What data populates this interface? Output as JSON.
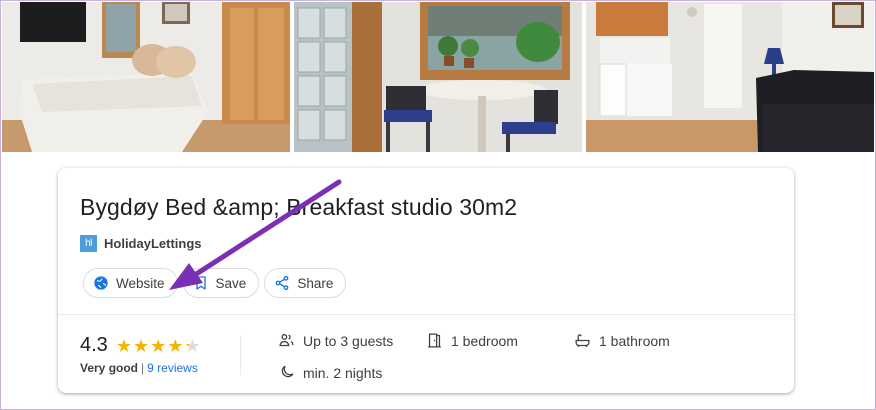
{
  "listing": {
    "title": "Bygdøy Bed &amp; Breakfast studio 30m2",
    "provider": {
      "logo_text": "hl",
      "name": "HolidayLettings",
      "logo_color": "#4b9fd9"
    },
    "actions": [
      {
        "label": "Website",
        "icon": "globe-icon"
      },
      {
        "label": "Save",
        "icon": "bookmark-icon"
      },
      {
        "label": "Share",
        "icon": "share-icon"
      }
    ],
    "rating": {
      "value": "4.3",
      "stars": 4.3,
      "max_stars": 5,
      "quality": "Very good",
      "separator": "|",
      "reviews": "9 reviews",
      "star_color": "#f4b400"
    },
    "features": [
      {
        "label": "Up to 3 guests",
        "icon": "guests-icon"
      },
      {
        "label": "1 bedroom",
        "icon": "door-icon"
      },
      {
        "label": "1 bathroom",
        "icon": "bathtub-icon"
      },
      {
        "label": "min. 2 nights",
        "icon": "moon-icon"
      }
    ]
  },
  "photos": [
    {
      "subject": "bedroom-photo"
    },
    {
      "subject": "dining-nook-photo"
    },
    {
      "subject": "kitchen-living-photo"
    }
  ],
  "annotation": {
    "arrow_color": "#7b2fb5"
  },
  "colors": {
    "link": "#1a73e8",
    "text": "#202124",
    "border": "#dadce0"
  }
}
